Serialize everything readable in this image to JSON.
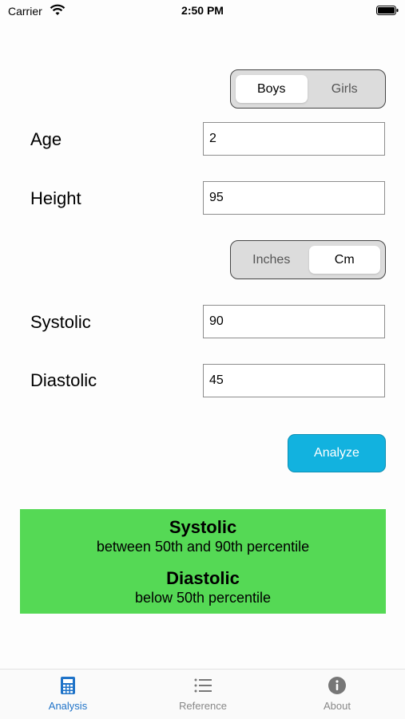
{
  "status_bar": {
    "carrier": "Carrier",
    "time": "2:50 PM"
  },
  "gender_toggle": {
    "options": [
      "Boys",
      "Girls"
    ],
    "selected": "Boys"
  },
  "fields": {
    "age": {
      "label": "Age",
      "value": "2"
    },
    "height": {
      "label": "Height",
      "value": "95"
    },
    "systolic": {
      "label": "Systolic",
      "value": "90"
    },
    "diastolic": {
      "label": "Diastolic",
      "value": "45"
    }
  },
  "unit_toggle": {
    "options": [
      "Inches",
      "Cm"
    ],
    "selected": "Cm"
  },
  "analyze_button": {
    "label": "Analyze"
  },
  "result": {
    "systolic_title": "Systolic",
    "systolic_text": "between 50th and 90th percentile",
    "diastolic_title": "Diastolic",
    "diastolic_text": "below 50th percentile",
    "background_color": "#55d955"
  },
  "tabs": [
    {
      "label": "Analysis",
      "icon": "calculator-icon",
      "active": true
    },
    {
      "label": "Reference",
      "icon": "list-icon",
      "active": false
    },
    {
      "label": "About",
      "icon": "info-icon",
      "active": false
    }
  ],
  "colors": {
    "accent": "#1f73c8",
    "button": "#12b2df"
  }
}
